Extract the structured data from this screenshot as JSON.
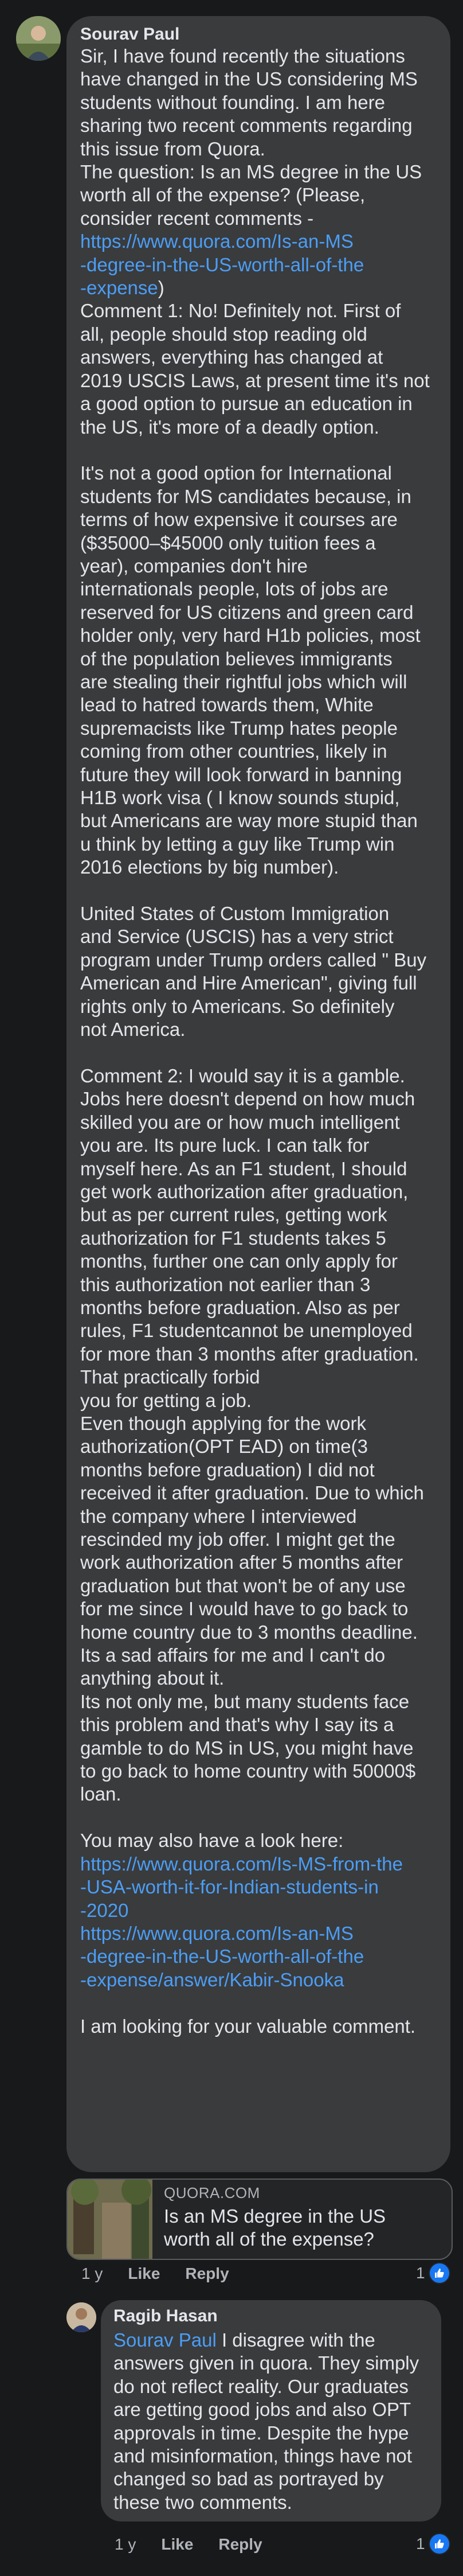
{
  "comment": {
    "author": "Sourav Paul",
    "body_before_link1": "Sir, I have found recently the situations\nhave changed in the US considering MS\nstudents without founding. I am here\nsharing two recent comments regarding\nthis issue from Quora.\nThe question: Is an MS degree in the US\nworth all of the expense? (Please,\nconsider recent comments -\n",
    "link1": "https://www.quora.com/Is-an-MS\n-degree-in-the-US-worth-all-of-the\n-expense",
    "body_middle": ")\nComment 1: No! Definitely not. First of\nall, people should stop reading old\nanswers, everything has changed at\n2019 USCIS Laws, at present time it's not\na good option to pursue an education in\nthe US, it's more of a deadly option.\n\nIt's not a good option for International\nstudents for MS candidates because, in\nterms of how expensive it courses are\n($35000–$45000 only tuition fees a\nyear), companies don't hire\ninternationals people, lots of jobs are\nreserved for US citizens and green card\nholder only, very hard H1b policies, most\nof the population believes immigrants\nare stealing their rightful jobs which will\nlead to hatred towards them, White\nsupremacists like Trump hates people\ncoming from other countries, likely in\nfuture they will look forward in banning\nH1B work visa ( I know sounds stupid,\nbut Americans are way more stupid than\nu think by letting a guy like Trump win\n2016 elections by big number).\n\nUnited States of Custom Immigration\nand Service (USCIS) has a very strict\nprogram under Trump orders called \" Buy\nAmerican and Hire American\", giving full\nrights only to Americans. So definitely\nnot America.\n\nComment 2: I would say it is a gamble.\nJobs here doesn't depend on how much\nskilled you are or how much intelligent\nyou are. Its pure luck. I can talk for\nmyself here. As an F1 student, I should\nget work authorization after graduation,\nbut as per current rules, getting work\nauthorization for F1 students takes 5\nmonths, further one can only apply for\nthis authorization not earlier than 3\nmonths before graduation. Also as per\nrules, F1 studentcannot be unemployed\nfor more than 3 months after graduation.\nThat practically forbid\nyou for getting a job.\nEven though applying for the work\nauthorization(OPT EAD) on time(3\nmonths before graduation) I did not\nreceived it after graduation. Due to which\nthe company where I interviewed\nrescinded my job offer. I might get the\nwork authorization after 5 months after\ngraduation but that won't be of any use\nfor me since I would have to go back to\nhome country due to 3 months deadline.\nIts a sad affairs for me and I can't do\nanything about it.\nIts not only me, but many students face\nthis problem and that's why I say its a\ngamble to do MS in US, you might have\nto go back to home country with 50000$\nloan.\n\nYou may also have a look here:\n",
    "link2": "https://www.quora.com/Is-MS-from-the\n-USA-worth-it-for-Indian-students-in\n-2020",
    "newline": "\n",
    "link3": "https://www.quora.com/Is-an-MS\n-degree-in-the-US-worth-all-of-the\n-expense/answer/Kabir-Snooka",
    "body_end": "\n\nI am looking for your valuable comment.",
    "preview": {
      "domain": "QUORA.COM",
      "title": "Is an MS degree in the US worth all of the expense?"
    },
    "meta": {
      "time": "1 y",
      "like": "Like",
      "reply": "Reply"
    },
    "reaction_count": "1"
  },
  "reply": {
    "author": "Ragib Hasan",
    "mention": "Sourav Paul",
    "body": " I disagree with the\nanswers given in quora. They simply\ndo not reflect reality. Our graduates\nare getting good jobs and also OPT\napprovals in time. Despite the hype\nand misinformation, things have not\nchanged so bad as portrayed by\nthese two comments.",
    "meta": {
      "time": "1 y",
      "like": "Like",
      "reply": "Reply"
    },
    "reaction_count": "1"
  },
  "colors": {
    "background": "#18191a",
    "bubble": "#3a3b3c",
    "link": "#4b9ef7",
    "like": "#1877f2"
  },
  "icons": {
    "like": "thumbs-up-icon"
  }
}
